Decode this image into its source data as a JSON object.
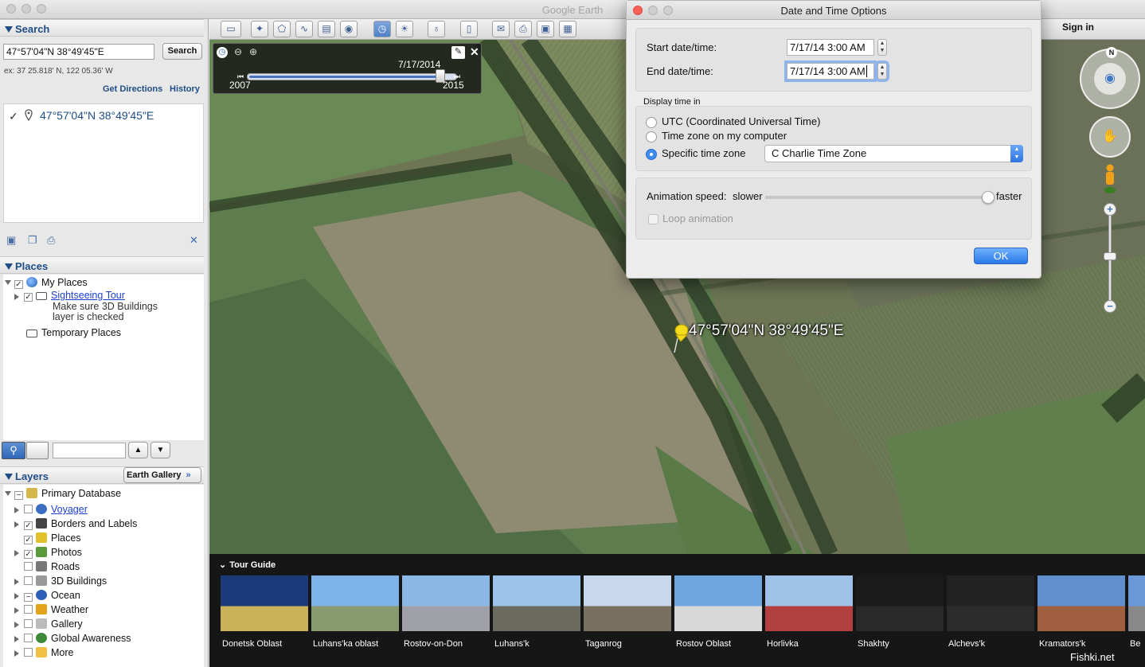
{
  "window": {
    "title": "Google Earth",
    "sign_in": "Sign in"
  },
  "search": {
    "header": "Search",
    "query": "47°57'04\"N 38°49'45\"E",
    "button": "Search",
    "example": "ex: 37 25.818' N, 122 05.36' W",
    "get_directions": "Get Directions",
    "history": "History",
    "result": "47°57'04\"N 38°49'45\"E"
  },
  "places": {
    "header": "Places",
    "my_places": "My Places",
    "tour_link": "Sightseeing Tour",
    "tour_note_1": "Make sure 3D Buildings",
    "tour_note_2": "layer is checked",
    "temporary": "Temporary Places"
  },
  "layers": {
    "header": "Layers",
    "gallery_button": "Earth Gallery",
    "items": [
      {
        "label": "Primary Database"
      },
      {
        "label": "Voyager"
      },
      {
        "label": "Borders and Labels"
      },
      {
        "label": "Places"
      },
      {
        "label": "Photos"
      },
      {
        "label": "Roads"
      },
      {
        "label": "3D Buildings"
      },
      {
        "label": "Ocean"
      },
      {
        "label": "Weather"
      },
      {
        "label": "Gallery"
      },
      {
        "label": "Global Awareness"
      },
      {
        "label": "More"
      }
    ]
  },
  "time_slider": {
    "current": "7/17/2014",
    "start_year": "2007",
    "end_year": "2015",
    "position_fraction": 0.92
  },
  "map": {
    "placemark_label": "47°57'04\"N 38°49'45\"E"
  },
  "dialog": {
    "title": "Date and Time Options",
    "start_label": "Start date/time:",
    "start_value": "7/17/14 3:00 AM",
    "end_label": "End date/time:",
    "end_value": "7/17/14 3:00 AM",
    "display_label": "Display time in",
    "utc": "UTC (Coordinated Universal Time)",
    "local": "Time zone on my computer",
    "specific": "Specific time zone",
    "zone": "C Charlie Time Zone",
    "anim_label": "Animation speed:",
    "slower": "slower",
    "faster": "faster",
    "loop": "Loop animation",
    "ok": "OK",
    "animation_speed_fraction": 0.98
  },
  "tour_guide": {
    "title": "Tour Guide",
    "items": [
      {
        "label": "Donetsk Oblast"
      },
      {
        "label": "Luhans'ka oblast"
      },
      {
        "label": "Rostov-on-Don"
      },
      {
        "label": "Luhans'k"
      },
      {
        "label": "Taganrog"
      },
      {
        "label": "Rostov Oblast"
      },
      {
        "label": "Horlivka"
      },
      {
        "label": "Shakhty"
      },
      {
        "label": "Alchevs'k"
      },
      {
        "label": "Kramators'k"
      },
      {
        "label": "Be"
      }
    ]
  },
  "watermark": "Fishki.net",
  "compass_letter": "N"
}
